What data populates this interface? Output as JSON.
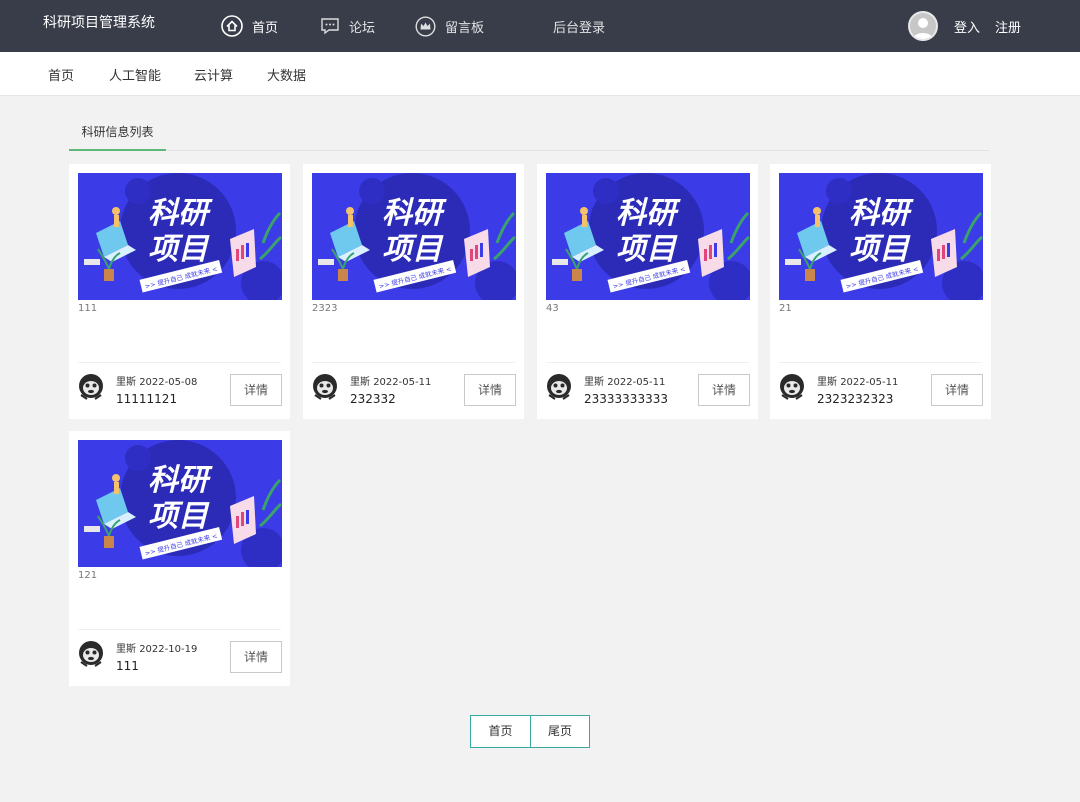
{
  "header": {
    "brand": "科研项目管理系统",
    "nav": [
      {
        "label": "首页",
        "icon": "home-icon"
      },
      {
        "label": "论坛",
        "icon": "message-icon"
      },
      {
        "label": "留言板",
        "icon": "crown-icon"
      },
      {
        "label": "后台登录"
      }
    ],
    "login": "登入",
    "register": "注册"
  },
  "subnav": [
    "首页",
    "人工智能",
    "云计算",
    "大数据"
  ],
  "section": {
    "tab_label": "科研信息列表"
  },
  "banner": {
    "title_line1": "科研",
    "title_line2": "项目",
    "slogan": ">> 提升自己  成就未来 <"
  },
  "cards": [
    {
      "name": "111",
      "author": "里斯",
      "date": "2022-05-08",
      "code": "11111121",
      "button": "详情"
    },
    {
      "name": "2323",
      "author": "里斯",
      "date": "2022-05-11",
      "code": "232332",
      "button": "详情"
    },
    {
      "name": "43",
      "author": "里斯",
      "date": "2022-05-11",
      "code": "23333333333",
      "button": "详情"
    },
    {
      "name": "21",
      "author": "里斯",
      "date": "2022-05-11",
      "code": "2323232323",
      "button": "详情"
    },
    {
      "name": "121",
      "author": "里斯",
      "date": "2022-10-19",
      "code": "111",
      "button": "详情"
    }
  ],
  "pagination": {
    "first": "首页",
    "last": "尾页"
  },
  "colors": {
    "topbar": "#393d49",
    "accent": "#5fb878",
    "pager_border": "#3aa8a0",
    "banner_bg": "#3b3be8"
  }
}
